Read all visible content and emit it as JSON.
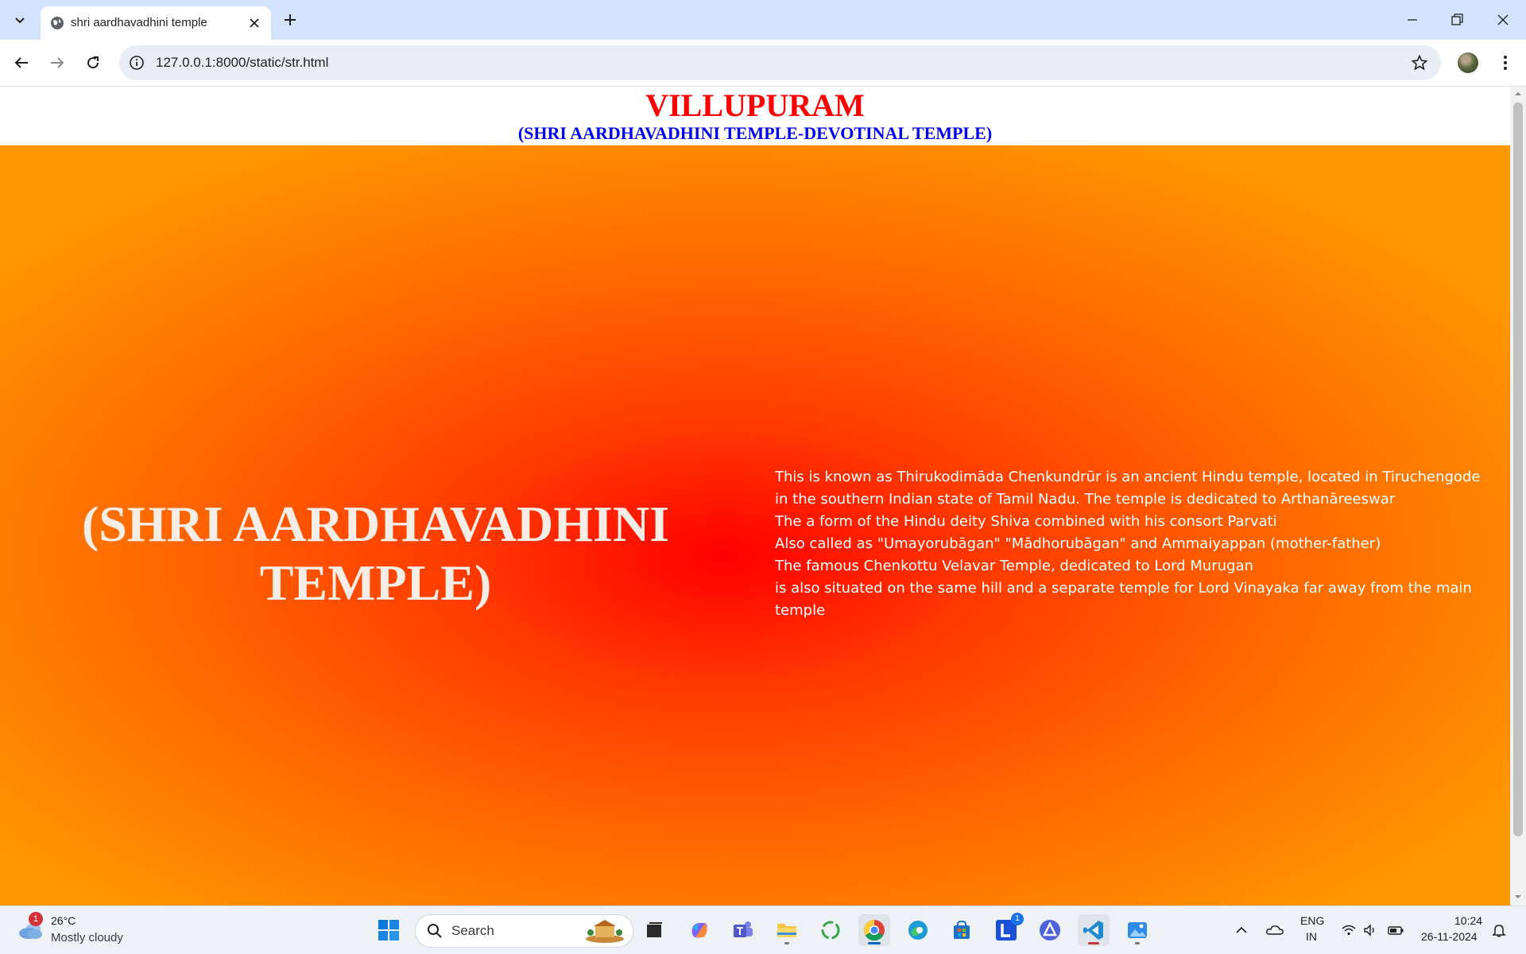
{
  "browser": {
    "tab_title": "shri aardhavadhini temple",
    "url": "127.0.0.1:8000/static/str.html"
  },
  "page": {
    "title": "VILLUPURAM",
    "subtitle": "(SHRI AARDHAVADHINI TEMPLE-DEVOTINAL TEMPLE)",
    "hero_heading": "(SHRI AARDHAVADHINI TEMPLE)",
    "description": [
      "This is known as Thirukodimāda Chenkundrūr is an ancient Hindu temple, located in Tiruchengode",
      "in the southern Indian state of Tamil Nadu. The temple is dedicated to Arthanāreeswar",
      "The a form of the Hindu deity Shiva combined with his consort Parvati",
      "Also called as \"Umayorubāgan\" \"Mādhorubāgan\" and Ammaiyappan (mother-father)",
      "The famous Chenkottu Velavar Temple, dedicated to Lord Murugan",
      "is also situated on the same hill and a separate temple for Lord Vinayaka far away from the main temple"
    ],
    "colors": {
      "title": "#ff0000",
      "subtitle": "#0000ee",
      "gradient_center": "#ff0000",
      "gradient_edge": "#ff9800"
    }
  },
  "taskbar": {
    "weather": {
      "badge": "1",
      "temp": "26°C",
      "condition": "Mostly cloudy"
    },
    "search_label": "Search",
    "lumen_badge": "1",
    "language": {
      "line1": "ENG",
      "line2": "IN"
    },
    "clock": {
      "time": "10:24",
      "date": "26-11-2024"
    }
  },
  "icons": [
    "tab-list-icon",
    "globe-icon",
    "close-icon",
    "plus-icon",
    "minimize-icon",
    "restore-icon",
    "window-close-icon",
    "back-icon",
    "forward-icon",
    "reload-icon",
    "info-icon",
    "star-icon",
    "more-icon"
  ]
}
